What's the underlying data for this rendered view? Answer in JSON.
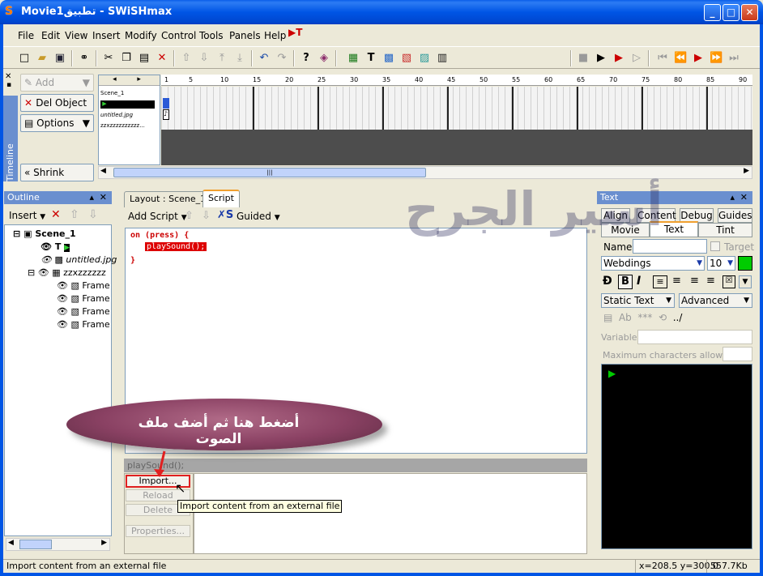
{
  "window": {
    "title": "Movie1تطبيق - SWiSHmax",
    "minimize": "_",
    "maximize": "□",
    "close": "✕"
  },
  "menu": [
    "File",
    "Edit",
    "View",
    "Insert",
    "Modify",
    "Control",
    "Tools",
    "Panels",
    "Help"
  ],
  "timeline": {
    "side_label": "Timeline",
    "add_label": "Add",
    "del_label": "Del Object",
    "options_label": "Options",
    "shrink_label": "Shrink",
    "layers": [
      "Scene_1",
      "",
      "untitled.jpg",
      "zzxzzzzzzzzzz..."
    ],
    "ruler_ticks": [
      "1",
      "5",
      "10",
      "15",
      "20",
      "25",
      "30",
      "35",
      "40",
      "45",
      "50",
      "55",
      "60",
      "65",
      "70",
      "75",
      "80",
      "85",
      "90"
    ],
    "scroll_grip": "|||"
  },
  "outline": {
    "title": "Outline",
    "insert_label": "Insert",
    "items": [
      {
        "label": "Scene_1",
        "bold": true
      },
      {
        "label": "T"
      },
      {
        "label": "untitled.jpg"
      },
      {
        "label": "zzxzzzzzz"
      },
      {
        "label": "Frame"
      },
      {
        "label": "Frame"
      },
      {
        "label": "Frame"
      },
      {
        "label": "Frame"
      }
    ]
  },
  "script_panel": {
    "tabs": [
      "Layout : Scene_1",
      "Script"
    ],
    "add_script_label": "Add Script",
    "guided_label": "Guided",
    "code_line1": "on (press) {",
    "code_line2": "playSound();",
    "code_line3": "}",
    "bar_text": "playSound();",
    "buttons": {
      "import": "Import...",
      "reload": "Reload",
      "delete": "Delete",
      "properties": "Properties..."
    },
    "tooltip": "Import content from an external file"
  },
  "text_panel": {
    "title": "Text",
    "tabs_row1": [
      "Align",
      "Content",
      "Debug",
      "Guides"
    ],
    "tabs_row2": [
      "Movie",
      "Text",
      "Tint"
    ],
    "name_label": "Name:",
    "target_label": "Target",
    "font": "Webdings",
    "size": "10",
    "text_type": "Static Text",
    "advanced": "Advanced",
    "variable_label": "Variable:",
    "max_chars_label": "Maximum characters allowed:",
    "accent_color": "#00cc00"
  },
  "annotation": {
    "oval_text": "أضغط هنا ثم أضف ملف الصوت",
    "watermark": "أسير الجرح"
  },
  "status": {
    "message": "Import content from an external file",
    "coords": "x=208.5 y=300.0",
    "size": "557.7Kb"
  }
}
